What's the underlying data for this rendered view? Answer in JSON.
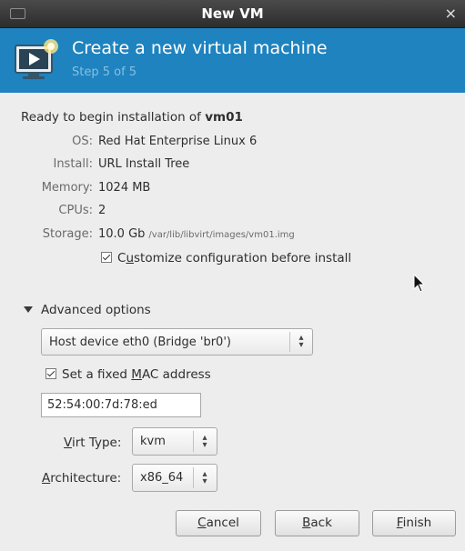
{
  "window": {
    "title": "New VM",
    "close": "×"
  },
  "header": {
    "title": "Create a new virtual machine",
    "step": "Step 5 of 5"
  },
  "summary": {
    "ready_prefix": "Ready to begin installation of ",
    "vm_name": "vm01",
    "rows": [
      {
        "label": "OS:",
        "value": "Red Hat Enterprise Linux 6"
      },
      {
        "label": "Install:",
        "value": "URL Install Tree"
      },
      {
        "label": "Memory:",
        "value": "1024 MB"
      },
      {
        "label": "CPUs:",
        "value": "2"
      },
      {
        "label": "Storage:",
        "value": "10.0 Gb",
        "path": "/var/lib/libvirt/images/vm01.img"
      }
    ]
  },
  "customize": {
    "pre": "C",
    "mn": "u",
    "post": "stomize configuration before install",
    "checked": true
  },
  "advanced": {
    "label": "Advanced options",
    "network": "Host device eth0 (Bridge 'br0')",
    "mac_chk": {
      "pre": "Set a fixed ",
      "mn": "M",
      "post": "AC address",
      "checked": true
    },
    "mac_value": "52:54:00:7d:78:ed",
    "virt_type_label": {
      "mn": "V",
      "post": "irt Type:"
    },
    "virt_type": "kvm",
    "arch_label": {
      "mn": "A",
      "post": "rchitecture:"
    },
    "arch": "x86_64"
  },
  "buttons": {
    "cancel": {
      "mn": "C",
      "post": "ancel"
    },
    "back": {
      "mn": "B",
      "post": "ack"
    },
    "finish": {
      "mn": "F",
      "post": "inish"
    }
  },
  "icons": {
    "menu": "window-menu-icon",
    "vm": "virtual-machine-icon",
    "cursor": "mouse-pointer-icon"
  }
}
